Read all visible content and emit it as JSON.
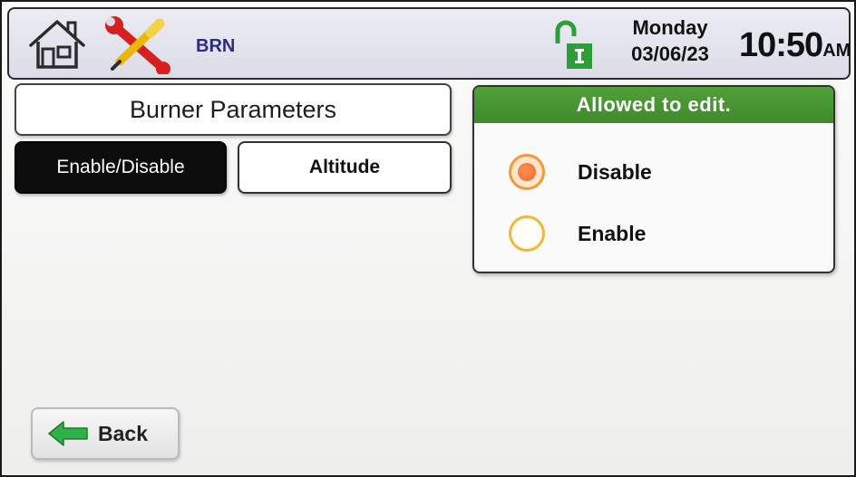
{
  "header": {
    "app_label": "BRN",
    "day": "Monday",
    "date": "03/06/23",
    "time": "10:50",
    "ampm": "AM",
    "icons": {
      "home": "home-icon",
      "tools": "tools-icon",
      "lock": "unlocked-padlock-icon"
    }
  },
  "page": {
    "title": "Burner Parameters"
  },
  "tabs": {
    "enable_disable": {
      "label": "Enable/Disable",
      "selected": true
    },
    "altitude": {
      "label": "Altitude",
      "selected": false
    }
  },
  "edit_panel": {
    "header": "Allowed to edit.",
    "options": [
      {
        "label": "Disable",
        "checked": true
      },
      {
        "label": "Enable",
        "checked": false
      }
    ]
  },
  "footer": {
    "back_label": "Back",
    "back_icon": "arrow-left-icon"
  },
  "colors": {
    "panel_header_green": "#3f8a2c",
    "radio_orange": "#f0682a",
    "radio_ring": "#f0b73a",
    "app_label_blue": "#2d2a86",
    "lock_green": "#2e9e3a"
  }
}
